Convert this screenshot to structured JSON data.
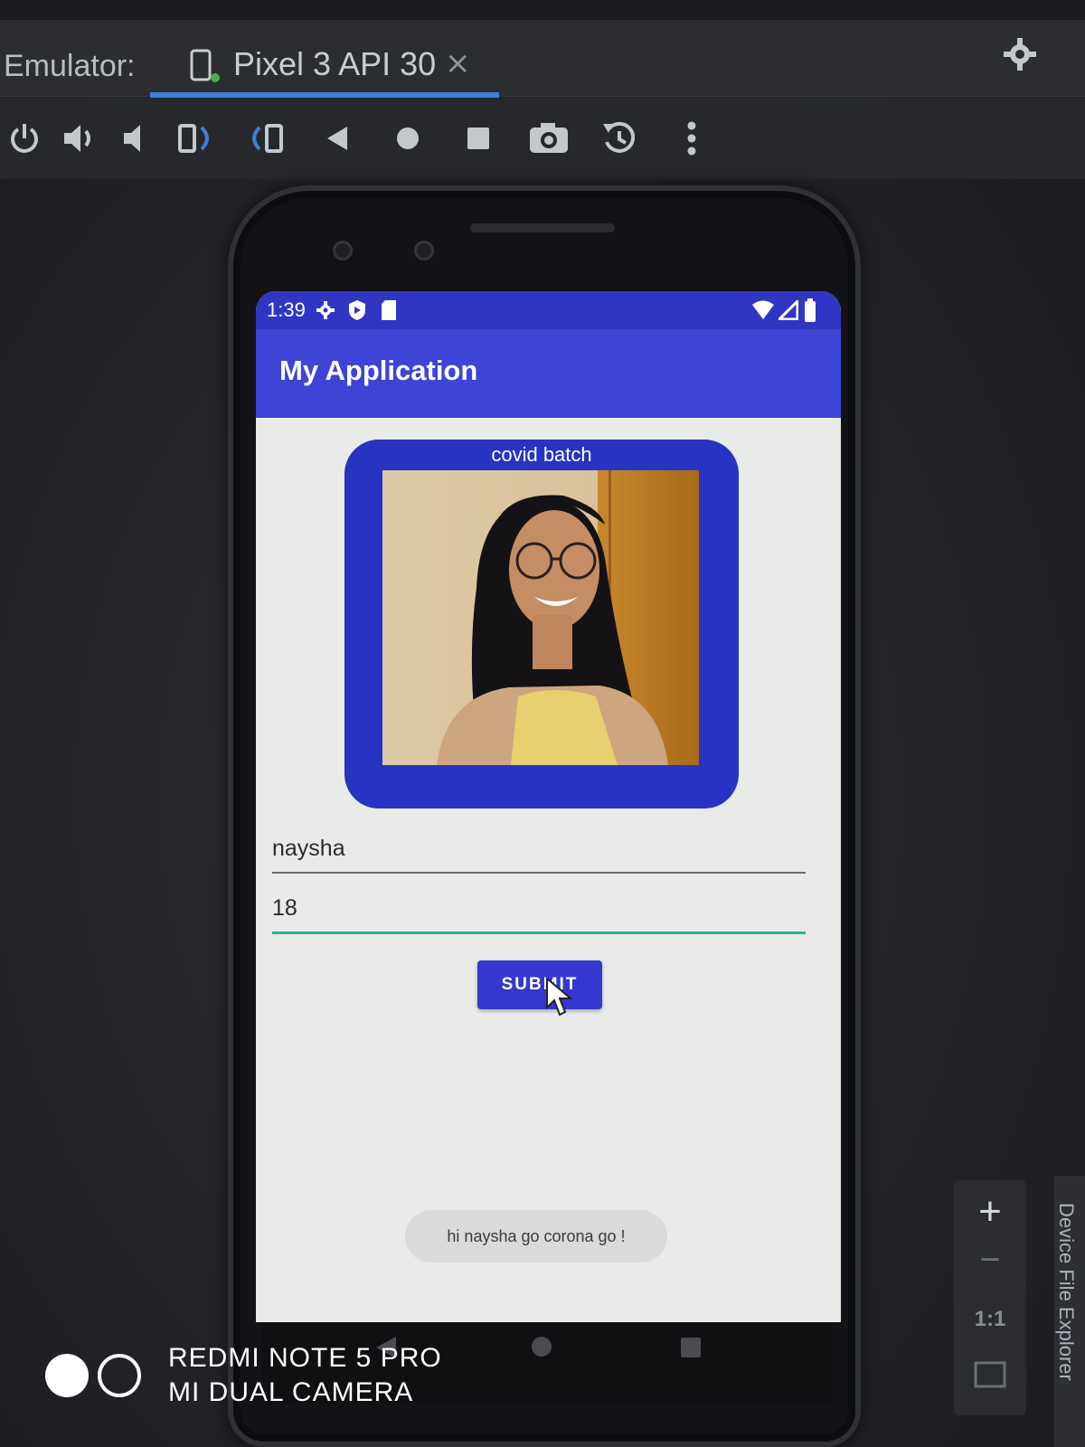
{
  "ide": {
    "emulator_label": "Emulator:",
    "device_tab": {
      "title": "Pixel 3 API 30",
      "close": "×"
    },
    "toolbar_icons": [
      "power-icon",
      "volume-up-icon",
      "volume-down-icon",
      "rotate-left-icon",
      "rotate-right-icon",
      "back-icon",
      "home-icon",
      "overview-icon",
      "camera-icon",
      "snapshot-icon",
      "more-icon"
    ],
    "zoom": {
      "plus": "+",
      "minus": "−",
      "ratio": "1:1"
    },
    "side_panel_label": "Device File Explorer"
  },
  "device": {
    "status_bar": {
      "time": "1:39",
      "bg": "#3036c4"
    },
    "app_bar": {
      "title": "My Application",
      "bg": "#3d44d6"
    },
    "card": {
      "caption": "covid batch",
      "bg": "#2733c2"
    },
    "name_input": {
      "value": "naysha"
    },
    "age_input": {
      "value": "18",
      "focus_color": "#26b59a"
    },
    "submit": {
      "label": "SUBMIT",
      "bg": "#3438d0"
    },
    "toast": {
      "message": "hi naysha go corona go !"
    }
  },
  "camera_watermark": {
    "line1": "REDMI NOTE 5 PRO",
    "line2": "MI DUAL CAMERA"
  }
}
